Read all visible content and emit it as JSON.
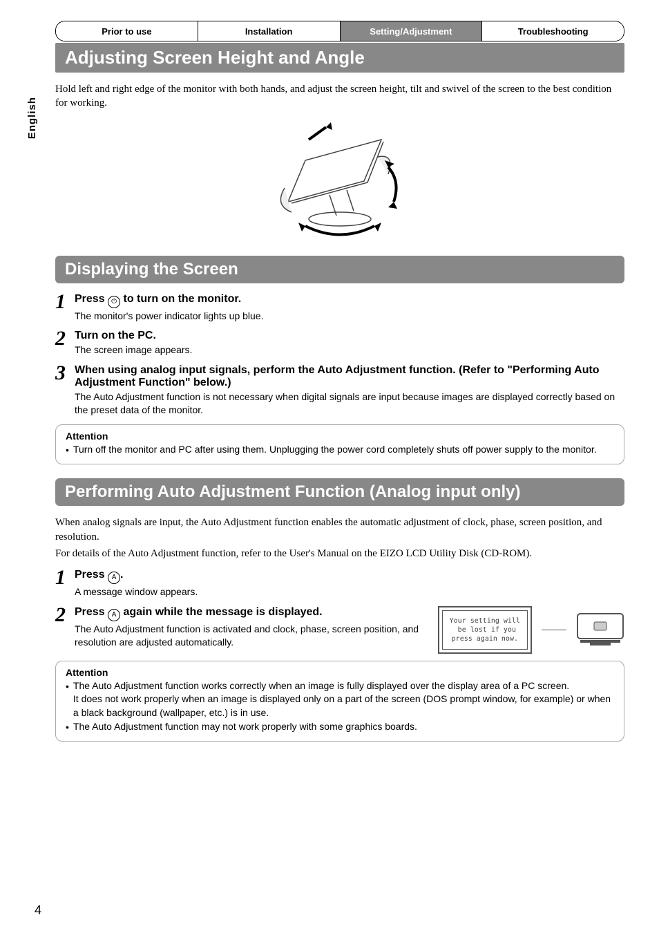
{
  "side_tab": "English",
  "tabs": {
    "t1": "Prior to use",
    "t2": "Installation",
    "t3": "Setting/Adjustment",
    "t4": "Troubleshooting"
  },
  "page_title": "Adjusting Screen Height and Angle",
  "intro": "Hold left and right edge of the monitor with both hands, and adjust the screen height, tilt and swivel of the screen to the best condition for working.",
  "section1": {
    "title": "Displaying the Screen",
    "step1_title_a": "Press ",
    "step1_title_b": " to turn on the monitor.",
    "step1_desc": "The monitor's power indicator lights up blue.",
    "step2_title": "Turn on the PC.",
    "step2_desc": "The screen image appears.",
    "step3_title": "When using analog input signals, perform the Auto Adjustment function. (Refer to \"Performing Auto Adjustment Function\" below.)",
    "step3_desc": "The Auto Adjustment function is not necessary when digital signals are input because images are displayed correctly based on the preset data of the monitor.",
    "attention_title": "Attention",
    "attention_text": "Turn off the monitor and PC after using them. Unplugging the power cord completely shuts off power supply to the monitor."
  },
  "section2": {
    "title": "Performing Auto Adjustment Function (Analog input only)",
    "intro1": "When analog signals are input, the Auto Adjustment function enables the automatic adjustment of  clock, phase, screen position, and resolution.",
    "intro2": "For details of the Auto Adjustment function, refer to the User's Manual on the EIZO LCD Utility Disk (CD-ROM).",
    "step1_title_a": "Press ",
    "step1_title_b": ".",
    "step1_desc": "A message window appears.",
    "step2_title_a": "Press ",
    "step2_title_b": " again while the message is displayed.",
    "step2_desc": "The Auto Adjustment function is activated and clock, phase, screen position, and resolution are adjusted automatically.",
    "msg_window": "Your setting will\n be lost if you\npress again now.",
    "attention_title": "Attention",
    "attention_b1a": "The Auto Adjustment function works correctly when an image is fully displayed over the display area of a PC screen.",
    "attention_b1b": "It does not work properly when an image is displayed only on a part of the screen (DOS prompt window, for example) or when a black background (wallpaper, etc.) is in use.",
    "attention_b2": "The Auto Adjustment function may not work properly with some graphics boards."
  },
  "page_number": "4",
  "icons": {
    "power": "⏻",
    "a": "A"
  },
  "chart_data": {
    "type": "table",
    "note": "This page is a textual manual page; no quantitative chart data is present."
  }
}
